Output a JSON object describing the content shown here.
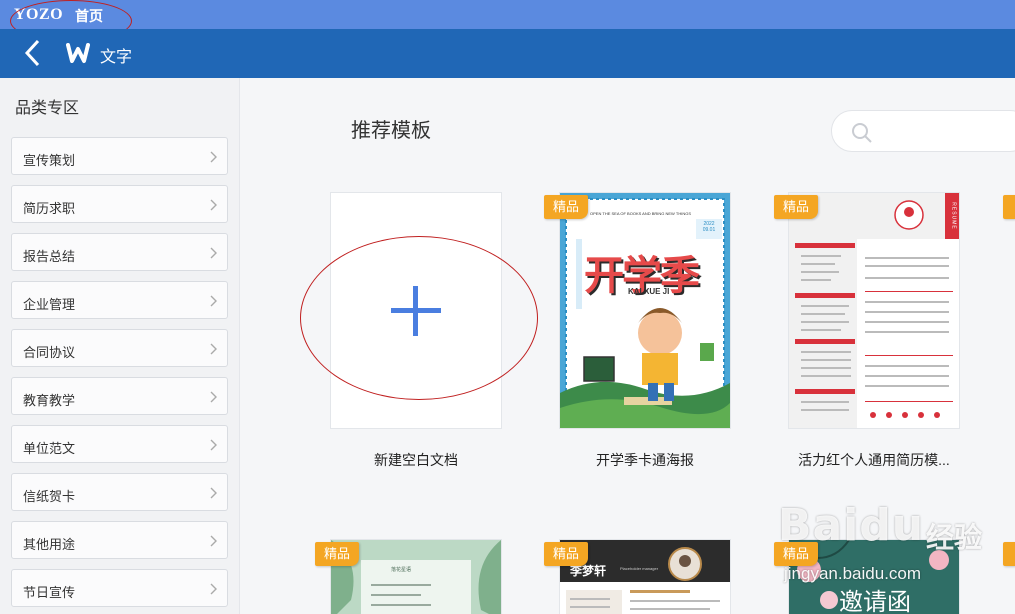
{
  "topbar": {
    "brand": "YOZO",
    "home": "首页"
  },
  "navbar": {
    "title": "文字"
  },
  "sidebar": {
    "title": "品类专区",
    "items": [
      {
        "label": "宣传策划"
      },
      {
        "label": "简历求职"
      },
      {
        "label": "报告总结"
      },
      {
        "label": "企业管理"
      },
      {
        "label": "合同协议"
      },
      {
        "label": "教育教学"
      },
      {
        "label": "单位范文"
      },
      {
        "label": "信纸贺卡"
      },
      {
        "label": "其他用途"
      },
      {
        "label": "节日宣传"
      }
    ]
  },
  "main": {
    "section_title": "推荐模板",
    "cards": [
      {
        "caption": "新建空白文档"
      },
      {
        "caption": "开学季卡通海报",
        "badge": "精品",
        "poster_title": "开学季",
        "poster_sub": "KAI XUE JI",
        "poster_top": "OPEN THE SEA OF BOOKS AND BRING NEW THINGS",
        "poster_date": "2022 09.01"
      },
      {
        "caption": "活力红个人通用简历模...",
        "badge": "精品",
        "resume_side": "RESUME"
      },
      {
        "badge": "精品",
        "text_top": "落花星语"
      },
      {
        "badge": "精品",
        "name": "李梦轩",
        "subtitle": "Placeholder manager"
      },
      {
        "badge": "精品",
        "title": "邀请函"
      }
    ]
  },
  "watermark": {
    "brand": "Baidu",
    "cn": "经验",
    "url": "jingyan.baidu.com"
  },
  "colors": {
    "topbar": "#5b8ae0",
    "navbar": "#2067b6",
    "badge": "#f4a623",
    "plus": "#4a7ee0",
    "annotation": "#c02020"
  }
}
